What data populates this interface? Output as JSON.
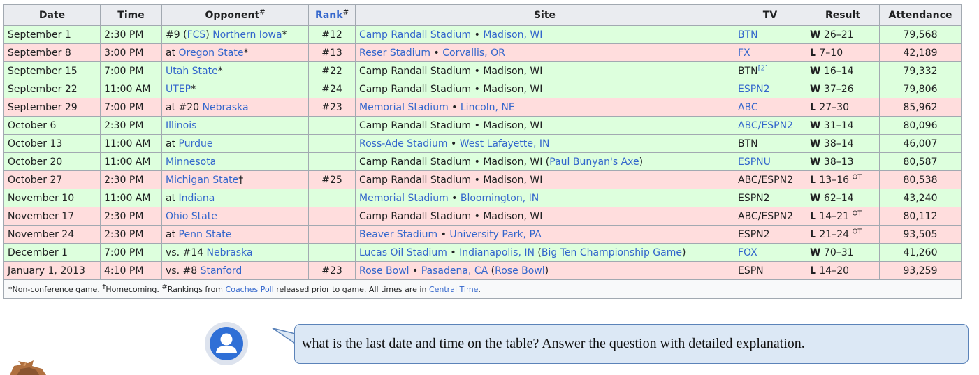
{
  "table": {
    "headers": {
      "date": "Date",
      "time": "Time",
      "opponent": "Opponent",
      "opponent_sup": "#",
      "rank": "Rank",
      "rank_sup": "#",
      "site": "Site",
      "tv": "TV",
      "result": "Result",
      "attendance": "Attendance"
    },
    "rows": [
      {
        "outcome": "win",
        "date": "September 1",
        "time": "2:30 PM",
        "opp_pre": "#9 (",
        "opp_mid": "FCS",
        "opp_gap": ") ",
        "opp_link": "Northern Iowa",
        "opp_post": "*",
        "rank": "#12",
        "site_a": "Camp Randall Stadium",
        "site_b": "Madison, WI",
        "site_c": "",
        "site_linked": true,
        "tv": "BTN",
        "tv_sup": "",
        "tv_linked": true,
        "res_letter": "W",
        "res_score": "26–21",
        "res_ot": "",
        "attendance": "79,568"
      },
      {
        "outcome": "loss",
        "date": "September 8",
        "time": "3:00 PM",
        "opp_pre": "at ",
        "opp_mid": "",
        "opp_gap": "",
        "opp_link": "Oregon State",
        "opp_post": "*",
        "rank": "#13",
        "site_a": "Reser Stadium",
        "site_b": "Corvallis, OR",
        "site_c": "",
        "site_linked": true,
        "tv": "FX",
        "tv_sup": "",
        "tv_linked": true,
        "res_letter": "L",
        "res_score": "7–10",
        "res_ot": "",
        "attendance": "42,189"
      },
      {
        "outcome": "win",
        "date": "September 15",
        "time": "7:00 PM",
        "opp_pre": "",
        "opp_mid": "",
        "opp_gap": "",
        "opp_link": "Utah State",
        "opp_post": "*",
        "rank": "#22",
        "site_a": "Camp Randall Stadium",
        "site_b": "Madison, WI",
        "site_c": "",
        "site_linked": false,
        "tv": "BTN",
        "tv_sup": "[2]",
        "tv_linked": false,
        "res_letter": "W",
        "res_score": "16–14",
        "res_ot": "",
        "attendance": "79,332"
      },
      {
        "outcome": "win",
        "date": "September 22",
        "time": "11:00 AM",
        "opp_pre": "",
        "opp_mid": "",
        "opp_gap": "",
        "opp_link": "UTEP",
        "opp_post": "*",
        "rank": "#24",
        "site_a": "Camp Randall Stadium",
        "site_b": "Madison, WI",
        "site_c": "",
        "site_linked": false,
        "tv": "ESPN2",
        "tv_sup": "",
        "tv_linked": true,
        "res_letter": "W",
        "res_score": "37–26",
        "res_ot": "",
        "attendance": "79,806"
      },
      {
        "outcome": "loss",
        "date": "September 29",
        "time": "7:00 PM",
        "opp_pre": "at #20 ",
        "opp_mid": "",
        "opp_gap": "",
        "opp_link": "Nebraska",
        "opp_post": "",
        "rank": "#23",
        "site_a": "Memorial Stadium",
        "site_b": "Lincoln, NE",
        "site_c": "",
        "site_linked": true,
        "tv": "ABC",
        "tv_sup": "",
        "tv_linked": true,
        "res_letter": "L",
        "res_score": "27–30",
        "res_ot": "",
        "attendance": "85,962"
      },
      {
        "outcome": "win",
        "date": "October 6",
        "time": "2:30 PM",
        "opp_pre": "",
        "opp_mid": "",
        "opp_gap": "",
        "opp_link": "Illinois",
        "opp_post": "",
        "rank": "",
        "site_a": "Camp Randall Stadium",
        "site_b": "Madison, WI",
        "site_c": "",
        "site_linked": false,
        "tv": "ABC/ESPN2",
        "tv_sup": "",
        "tv_linked": true,
        "res_letter": "W",
        "res_score": "31–14",
        "res_ot": "",
        "attendance": "80,096"
      },
      {
        "outcome": "win",
        "date": "October 13",
        "time": "11:00 AM",
        "opp_pre": "at ",
        "opp_mid": "",
        "opp_gap": "",
        "opp_link": "Purdue",
        "opp_post": "",
        "rank": "",
        "site_a": "Ross-Ade Stadium",
        "site_b": "West Lafayette, IN",
        "site_c": "",
        "site_linked": true,
        "tv": "BTN",
        "tv_sup": "",
        "tv_linked": false,
        "res_letter": "W",
        "res_score": "38–14",
        "res_ot": "",
        "attendance": "46,007"
      },
      {
        "outcome": "win",
        "date": "October 20",
        "time": "11:00 AM",
        "opp_pre": "",
        "opp_mid": "",
        "opp_gap": "",
        "opp_link": "Minnesota",
        "opp_post": "",
        "rank": "",
        "site_a": "Camp Randall Stadium",
        "site_b": "Madison, WI",
        "site_c": "Paul Bunyan's Axe",
        "site_linked": false,
        "tv": "ESPNU",
        "tv_sup": "",
        "tv_linked": true,
        "res_letter": "W",
        "res_score": "38–13",
        "res_ot": "",
        "attendance": "80,587"
      },
      {
        "outcome": "loss",
        "date": "October 27",
        "time": "2:30 PM",
        "opp_pre": "",
        "opp_mid": "",
        "opp_gap": "",
        "opp_link": "Michigan State",
        "opp_post": "†",
        "rank": "#25",
        "site_a": "Camp Randall Stadium",
        "site_b": "Madison, WI",
        "site_c": "",
        "site_linked": false,
        "tv": "ABC/ESPN2",
        "tv_sup": "",
        "tv_linked": false,
        "res_letter": "L",
        "res_score": "13–16",
        "res_ot": "OT",
        "attendance": "80,538"
      },
      {
        "outcome": "win",
        "date": "November 10",
        "time": "11:00 AM",
        "opp_pre": "at ",
        "opp_mid": "",
        "opp_gap": "",
        "opp_link": "Indiana",
        "opp_post": "",
        "rank": "",
        "site_a": "Memorial Stadium",
        "site_b": "Bloomington, IN",
        "site_c": "",
        "site_linked": true,
        "tv": "ESPN2",
        "tv_sup": "",
        "tv_linked": false,
        "res_letter": "W",
        "res_score": "62–14",
        "res_ot": "",
        "attendance": "43,240"
      },
      {
        "outcome": "loss",
        "date": "November 17",
        "time": "2:30 PM",
        "opp_pre": "",
        "opp_mid": "",
        "opp_gap": "",
        "opp_link": "Ohio State",
        "opp_post": "",
        "rank": "",
        "site_a": "Camp Randall Stadium",
        "site_b": "Madison, WI",
        "site_c": "",
        "site_linked": false,
        "tv": "ABC/ESPN2",
        "tv_sup": "",
        "tv_linked": false,
        "res_letter": "L",
        "res_score": "14–21",
        "res_ot": "OT",
        "attendance": "80,112"
      },
      {
        "outcome": "loss",
        "date": "November 24",
        "time": "2:30 PM",
        "opp_pre": "at ",
        "opp_mid": "",
        "opp_gap": "",
        "opp_link": "Penn State",
        "opp_post": "",
        "rank": "",
        "site_a": "Beaver Stadium",
        "site_b": "University Park, PA",
        "site_c": "",
        "site_linked": true,
        "tv": "ESPN2",
        "tv_sup": "",
        "tv_linked": false,
        "res_letter": "L",
        "res_score": "21–24",
        "res_ot": "OT",
        "attendance": "93,505"
      },
      {
        "outcome": "win",
        "date": "December 1",
        "time": "7:00 PM",
        "opp_pre": "vs. #14 ",
        "opp_mid": "",
        "opp_gap": "",
        "opp_link": "Nebraska",
        "opp_post": "",
        "rank": "",
        "site_a": "Lucas Oil Stadium",
        "site_b": "Indianapolis, IN",
        "site_c": "Big Ten Championship Game",
        "site_linked": true,
        "tv": "FOX",
        "tv_sup": "",
        "tv_linked": true,
        "res_letter": "W",
        "res_score": "70–31",
        "res_ot": "",
        "attendance": "41,260"
      },
      {
        "outcome": "loss",
        "date": "January 1, 2013",
        "time": "4:10 PM",
        "opp_pre": "vs. #8 ",
        "opp_mid": "",
        "opp_gap": "",
        "opp_link": "Stanford",
        "opp_post": "",
        "rank": "#23",
        "site_a": "Rose Bowl",
        "site_b": "Pasadena, CA",
        "site_c": "Rose Bowl",
        "site_linked": true,
        "tv": "ESPN",
        "tv_sup": "",
        "tv_linked": false,
        "res_letter": "L",
        "res_score": "14–20",
        "res_ot": "",
        "attendance": "93,259"
      }
    ],
    "footnote": {
      "p1": "*Non-conference game. ",
      "dagger": "†",
      "p2": "Homecoming. ",
      "hash": "#",
      "p3": "Rankings from ",
      "link1": "Coaches Poll",
      "p4": " released prior to game. All times are in ",
      "link2": "Central Time",
      "p5": "."
    },
    "site_separator": " • "
  },
  "chat": {
    "question": "what is the last date and time on the table? Answer the question with detailed explanation."
  },
  "colors": {
    "win_row": "#ddffdd",
    "loss_row": "#ffdddd",
    "link": "#3366cc",
    "header_bg": "#eaecf0",
    "bubble_bg": "#dce8f5",
    "bubble_border": "#5b83b9",
    "avatar_blue": "#2f6fd6"
  }
}
